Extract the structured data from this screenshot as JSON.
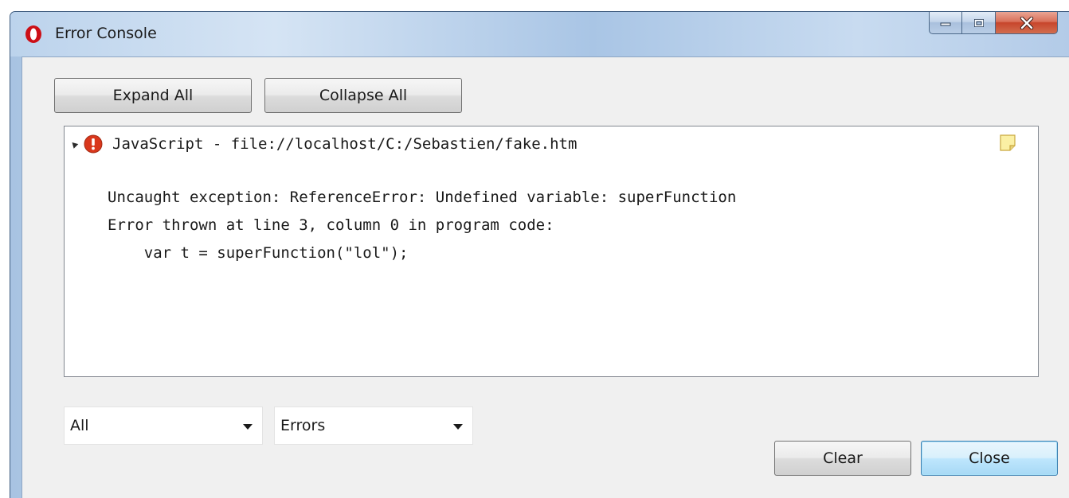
{
  "window": {
    "title": "Error Console"
  },
  "toolbar": {
    "expand_all_label": "Expand All",
    "collapse_all_label": "Collapse All"
  },
  "console": {
    "entries": [
      {
        "header": "JavaScript - file://localhost/C:/Sebastien/fake.htm",
        "icon": "error-icon",
        "lines": [
          "Uncaught exception: ReferenceError: Undefined variable: superFunction",
          "Error thrown at line 3, column 0 in program code:",
          "    var t = superFunction(\"lol\");"
        ]
      }
    ]
  },
  "filters": {
    "source_selected": "All",
    "severity_selected": "Errors"
  },
  "footer": {
    "clear_label": "Clear",
    "close_label": "Close"
  },
  "colors": {
    "error_red": "#d9371c",
    "primary_button_border": "#3c7fb1",
    "close_caption_red": "#c7452c"
  }
}
